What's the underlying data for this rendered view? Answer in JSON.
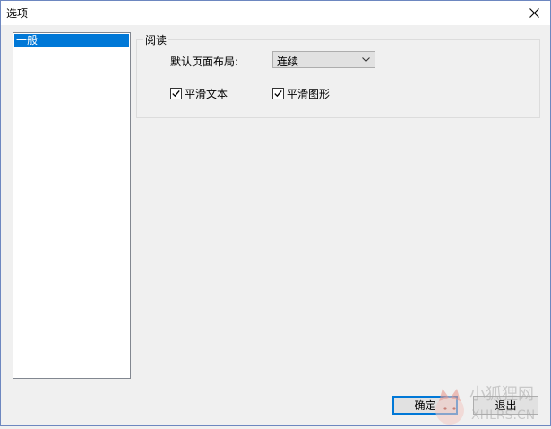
{
  "window": {
    "title": "选项"
  },
  "sidebar": {
    "items": [
      {
        "label": "一般",
        "selected": true
      }
    ]
  },
  "reading": {
    "group_label": "阅读",
    "layout_label": "默认页面布局:",
    "layout_value": "连续",
    "smooth_text": {
      "label": "平滑文本",
      "checked": true
    },
    "smooth_graphics": {
      "label": "平滑图形",
      "checked": true
    }
  },
  "buttons": {
    "ok": "确定",
    "exit": "退出"
  },
  "watermark": {
    "text": "小狐狸网",
    "url": "XHLRS.CN"
  },
  "colors": {
    "selection": "#0078d7",
    "border": "#828790",
    "background": "#f0f0f0"
  }
}
